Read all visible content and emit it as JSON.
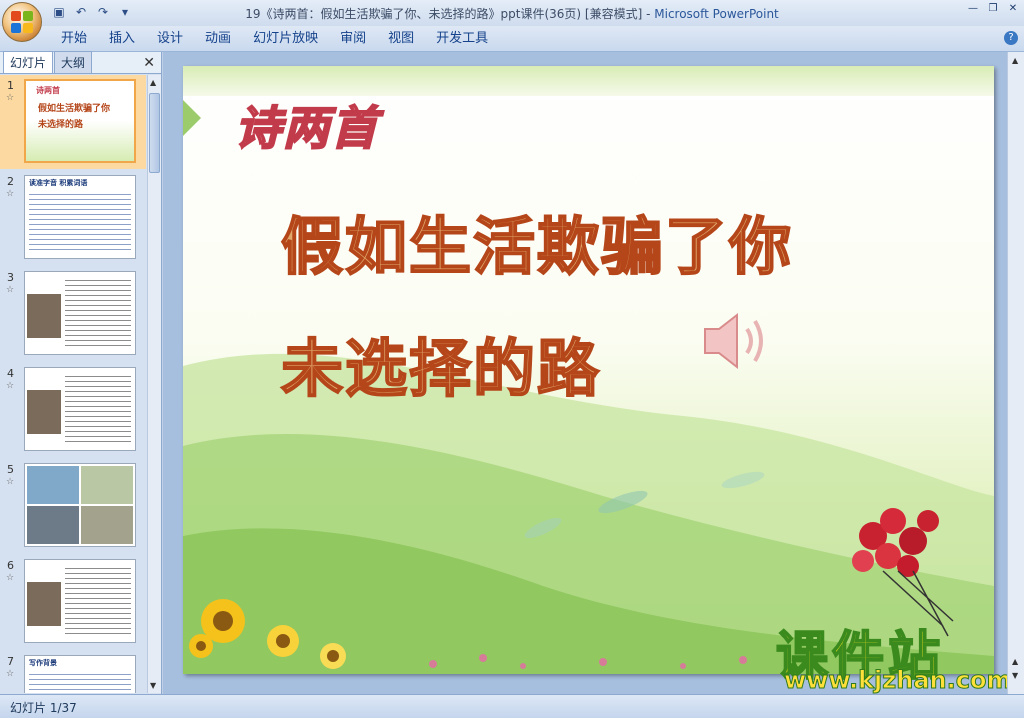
{
  "window": {
    "title": "19《诗两首：假如生活欺骗了你、未选择的路》ppt课件(36页) [兼容模式]",
    "app_name": "Microsoft PowerPoint",
    "title_sep": " - "
  },
  "qat": {
    "save": "▣",
    "undo": "↶",
    "redo": "↷",
    "more": "▾"
  },
  "ribbon": {
    "tabs": [
      "开始",
      "插入",
      "设计",
      "动画",
      "幻灯片放映",
      "审阅",
      "视图",
      "开发工具"
    ]
  },
  "panel": {
    "tab_slides": "幻灯片",
    "tab_outline": "大纲",
    "close": "✕"
  },
  "thumbnails": [
    {
      "num": "1",
      "title": "诗两首",
      "line1": "假如生活欺骗了你",
      "line2": "未选择的路"
    },
    {
      "num": "2",
      "title": "读准字音 积累词语"
    },
    {
      "num": "3",
      "title": ""
    },
    {
      "num": "4",
      "title": ""
    },
    {
      "num": "5",
      "title": ""
    },
    {
      "num": "6",
      "title": ""
    },
    {
      "num": "7",
      "title": "写作背景"
    }
  ],
  "slide": {
    "heading": "诗两首",
    "line1": "假如生活欺骗了你",
    "line2": "未选择的路",
    "watermark_cn": "课件站",
    "watermark_url": "www.kjzhan.com"
  },
  "status": {
    "text": "幻灯片 1/37"
  },
  "colors": {
    "accent": "#2b579a",
    "ribbon_text": "#15428b"
  }
}
